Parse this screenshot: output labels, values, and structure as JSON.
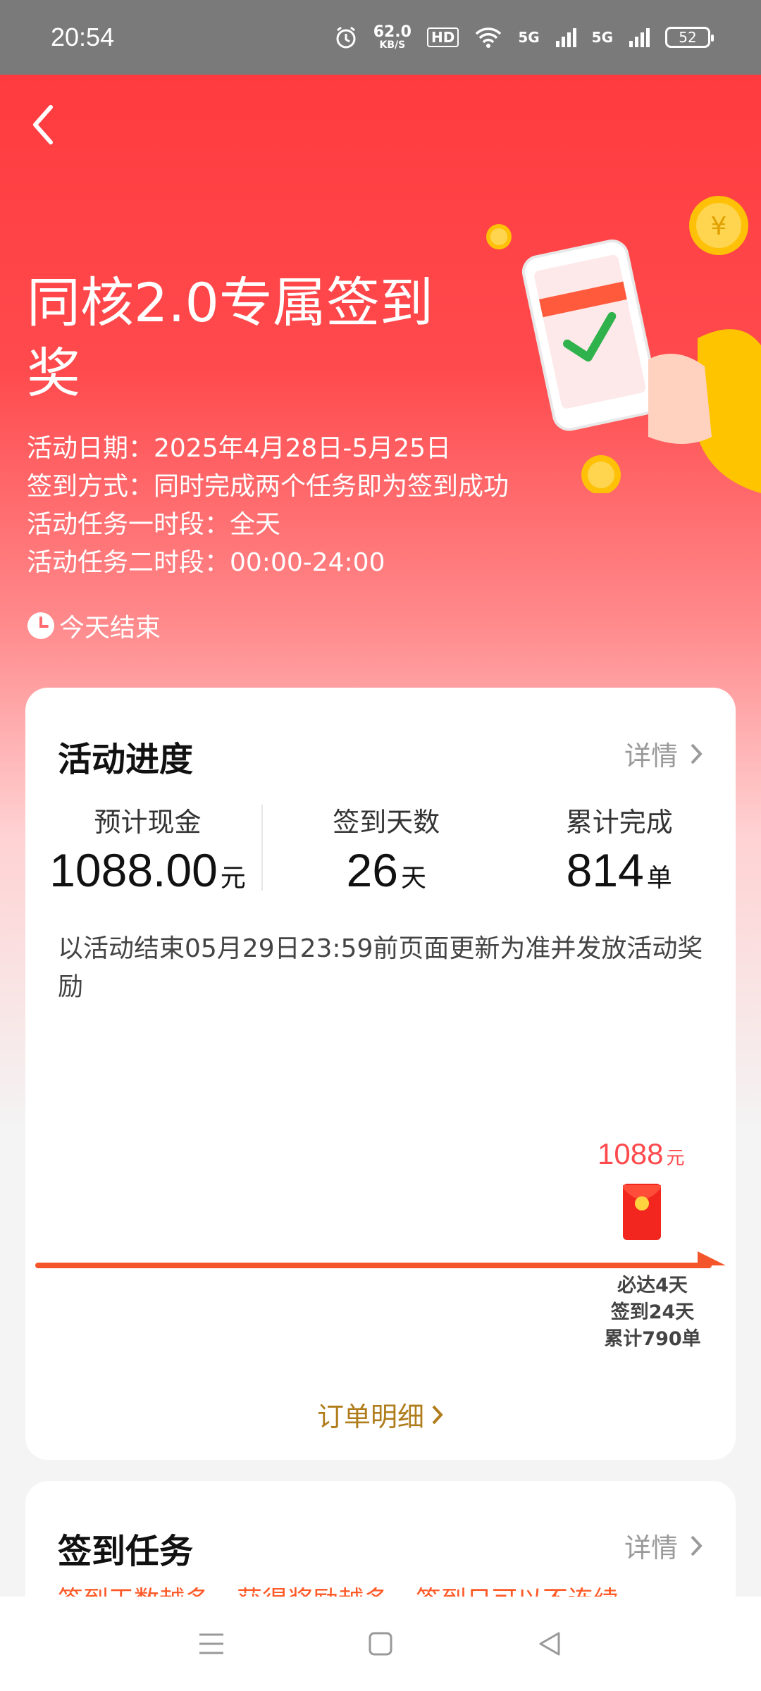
{
  "status_bar": {
    "time": "20:54",
    "net_speed": "62.0",
    "net_unit": "KB/S",
    "hd_label": "HD",
    "signal_labels": [
      "5G",
      "5G"
    ],
    "battery": "52"
  },
  "header": {
    "title": "同核2.0专属签到奖",
    "lines": [
      "活动日期：2025年4月28日-5月25日",
      "签到方式：同时完成两个任务即为签到成功",
      "活动任务一时段：全天",
      "活动任务二时段：00:00-24:00"
    ],
    "ends_text": "今天结束"
  },
  "progress_card": {
    "title": "活动进度",
    "detail_label": "详情",
    "stats": [
      {
        "label": "预计现金",
        "value": "1088.00",
        "unit": "元"
      },
      {
        "label": "签到天数",
        "value": "26",
        "unit": "天"
      },
      {
        "label": "累计完成",
        "value": "814",
        "unit": "单"
      }
    ],
    "note": "以活动结束05月29日23:59前页面更新为准并发放活动奖励",
    "milestone": {
      "amount": "1088",
      "amount_unit": "元",
      "conditions": [
        "必达4天",
        "签到24天",
        "累计790单"
      ]
    },
    "order_detail_label": "订单明细"
  },
  "tasks_card": {
    "title": "签到任务",
    "detail_label": "详情",
    "tags": [
      "签到天数越多",
      "获得奖励越多",
      "签到日可以不连续"
    ]
  },
  "colors": {
    "brand_red": "#ff3b3f",
    "accent_orange": "#ff5a28",
    "gold_text": "#b07d1c"
  }
}
